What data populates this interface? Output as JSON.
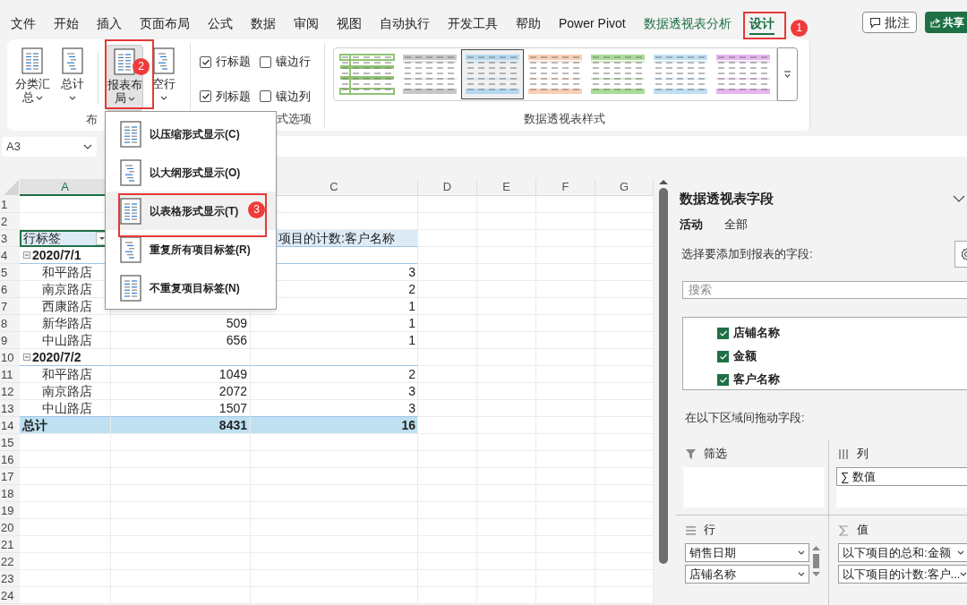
{
  "tabs": [
    {
      "label": "文件",
      "kind": "normal",
      "selected": false
    },
    {
      "label": "开始",
      "kind": "normal",
      "selected": false
    },
    {
      "label": "插入",
      "kind": "normal",
      "selected": false
    },
    {
      "label": "页面布局",
      "kind": "normal",
      "selected": false
    },
    {
      "label": "公式",
      "kind": "normal",
      "selected": false
    },
    {
      "label": "数据",
      "kind": "normal",
      "selected": false
    },
    {
      "label": "审阅",
      "kind": "normal",
      "selected": false
    },
    {
      "label": "视图",
      "kind": "normal",
      "selected": false
    },
    {
      "label": "自动执行",
      "kind": "normal",
      "selected": false
    },
    {
      "label": "开发工具",
      "kind": "normal",
      "selected": false
    },
    {
      "label": "帮助",
      "kind": "normal",
      "selected": false
    },
    {
      "label": "Power Pivot",
      "kind": "normal",
      "selected": false
    },
    {
      "label": "数据透视表分析",
      "kind": "context",
      "selected": false
    },
    {
      "label": "设计",
      "kind": "context",
      "selected": true
    }
  ],
  "header_buttons": [
    {
      "label": "批注",
      "kind": "comment"
    },
    {
      "label": "共享",
      "kind": "share"
    }
  ],
  "ribbon": {
    "layout_group": {
      "label": "布",
      "buttons": [
        {
          "label": "分类汇总",
          "pressed": false
        },
        {
          "label": "总计",
          "pressed": false
        },
        {
          "label": "报表布局",
          "pressed": true
        },
        {
          "label": "空行",
          "pressed": false
        }
      ]
    },
    "options_group": {
      "label": "式选项",
      "options": [
        {
          "label": "行标题",
          "checked": true
        },
        {
          "label": "镶边行",
          "checked": false
        },
        {
          "label": "列标题",
          "checked": true
        },
        {
          "label": "镶边列",
          "checked": false
        }
      ]
    },
    "styles_group": {
      "label": "数据透视表样式",
      "styles": [
        {
          "kind": "outline",
          "color": "#8fc472",
          "selected": false
        },
        {
          "kind": "banded",
          "color": "#c8c8c8",
          "selected": false
        },
        {
          "kind": "banded",
          "color": "#b4d8ef",
          "selected": true
        },
        {
          "kind": "banded",
          "color": "#f7cfb5",
          "selected": false
        },
        {
          "kind": "banded",
          "color": "#a9dc96",
          "selected": false
        },
        {
          "kind": "banded",
          "color": "#bfe0f3",
          "selected": false
        },
        {
          "kind": "banded",
          "color": "#e6b4ee",
          "selected": false
        }
      ]
    }
  },
  "name_box": "A3",
  "layout_menu": {
    "items": [
      {
        "label": "以压缩形式显示(C)",
        "highlighted": false
      },
      {
        "label": "以大纲形式显示(O)",
        "highlighted": false
      },
      {
        "label": "以表格形式显示(T)",
        "highlighted": true
      },
      {
        "label": "重复所有项目标签(R)",
        "highlighted": false
      },
      {
        "label": "不重复项目标签(N)",
        "highlighted": false
      }
    ]
  },
  "callouts": [
    {
      "label": "1"
    },
    {
      "label": "2"
    },
    {
      "label": "3"
    }
  ],
  "sheet": {
    "columns": [
      {
        "label": "A",
        "selected": true
      },
      {
        "label": "C",
        "selected": false
      },
      {
        "label": "D",
        "selected": false
      },
      {
        "label": "E",
        "selected": false
      },
      {
        "label": "F",
        "selected": false
      },
      {
        "label": "G",
        "selected": false
      }
    ],
    "rows": [
      {
        "number": "1",
        "kind": "blank"
      },
      {
        "number": "2",
        "kind": "blank"
      },
      {
        "number": "3",
        "kind": "header",
        "label": "行标签",
        "count": "项目的计数:客户名称"
      },
      {
        "number": "4",
        "kind": "group",
        "label": "2020/7/1"
      },
      {
        "number": "5",
        "kind": "item",
        "label": "和平路店",
        "count": "3"
      },
      {
        "number": "6",
        "kind": "item",
        "label": "南京路店",
        "count": "2"
      },
      {
        "number": "7",
        "kind": "item",
        "label": "西康路店",
        "count": "1"
      },
      {
        "number": "8",
        "kind": "item",
        "label": "新华路店",
        "amount": "509",
        "count": "1"
      },
      {
        "number": "9",
        "kind": "item",
        "label": "中山路店",
        "amount": "656",
        "count": "1"
      },
      {
        "number": "10",
        "kind": "group",
        "label": "2020/7/2"
      },
      {
        "number": "11",
        "kind": "item",
        "label": "和平路店",
        "amount": "1049",
        "count": "2"
      },
      {
        "number": "12",
        "kind": "item",
        "label": "南京路店",
        "amount": "2072",
        "count": "3"
      },
      {
        "number": "13",
        "kind": "item",
        "label": "中山路店",
        "amount": "1507",
        "count": "3"
      },
      {
        "number": "14",
        "kind": "total",
        "label": "总计",
        "amount": "8431",
        "count": "16"
      },
      {
        "number": "15",
        "kind": "blank"
      },
      {
        "number": "16",
        "kind": "blank"
      },
      {
        "number": "17",
        "kind": "blank"
      },
      {
        "number": "18",
        "kind": "blank"
      },
      {
        "number": "19",
        "kind": "blank"
      },
      {
        "number": "20",
        "kind": "blank"
      },
      {
        "number": "21",
        "kind": "blank"
      },
      {
        "number": "22",
        "kind": "blank"
      },
      {
        "number": "23",
        "kind": "blank"
      },
      {
        "number": "24",
        "kind": "blank"
      }
    ]
  },
  "field_pane": {
    "title": "数据透视表字段",
    "tabs": [
      {
        "label": "活动",
        "selected": true
      },
      {
        "label": "全部",
        "selected": false
      }
    ],
    "prompt": "选择要添加到报表的字段:",
    "search_placeholder": "搜索",
    "fields": [
      {
        "label": "店铺名称",
        "checked": true
      },
      {
        "label": "金额",
        "checked": true
      },
      {
        "label": "客户名称",
        "checked": true
      }
    ],
    "drag_prompt": "在以下区域间拖动字段:",
    "areas": [
      {
        "kind": "filter",
        "label": "筛选"
      },
      {
        "kind": "columns",
        "label": "列",
        "items": [
          "∑ 数值"
        ]
      },
      {
        "kind": "rows",
        "label": "行",
        "items": [
          "销售日期",
          "店铺名称"
        ]
      },
      {
        "kind": "values",
        "label": "值",
        "items": [
          "以下项目的总和:金额",
          "以下项目的计数:客户..."
        ]
      }
    ]
  }
}
